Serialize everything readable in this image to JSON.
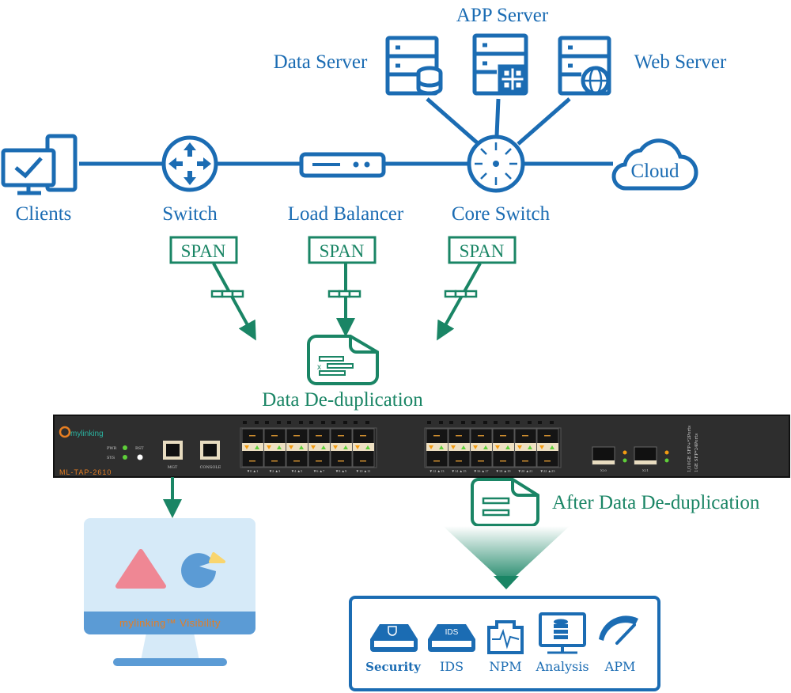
{
  "colors": {
    "network_blue": "#1b6cb3",
    "span_green": "#1a8565",
    "device_body": "#2e2e2e",
    "brand_orange": "#e67e22"
  },
  "topology": {
    "clients": "Clients",
    "switch": "Switch",
    "load_balancer": "Load Balancer",
    "core_switch": "Core Switch",
    "cloud": "Cloud",
    "data_server": "Data Server",
    "app_server": "APP Server",
    "web_server": "Web Server"
  },
  "span": {
    "label_1": "SPAN",
    "label_2": "SPAN",
    "label_3": "SPAN"
  },
  "dedup": {
    "title": "Data De-duplication",
    "after": "After Data De-duplication"
  },
  "device": {
    "brand": "mylinking",
    "trademark": "TM",
    "model": "ML-TAP-2610",
    "pwr": "PWR",
    "sys": "SYS",
    "rst": "RST",
    "mgt": "MGT",
    "console": "CONSOLE",
    "ports_group1": [
      "▼0 ▲1",
      "▼2 ▲3",
      "▼4 ▲5",
      "▼6 ▲7",
      "▼8 ▲9",
      "▼10 ▲11"
    ],
    "ports_group2": [
      "▼12 ▲13",
      "▼14 ▲15",
      "▼16 ▲17",
      "▼18 ▲19",
      "▼20 ▲21",
      "▼22 ▲23"
    ],
    "x_ports": [
      "X20",
      "X21"
    ],
    "side_text_1": "1/10GE SFP+*2Ports",
    "side_text_2": "1GE SFP*24Ports"
  },
  "monitor": {
    "caption": "mylinking™ Visibility"
  },
  "tools": [
    {
      "label": "Security",
      "icon": "shield-appliance-icon"
    },
    {
      "label": "IDS",
      "icon": "ids-appliance-icon",
      "badge": "IDS"
    },
    {
      "label": "NPM",
      "icon": "network-port-pulse-icon"
    },
    {
      "label": "Analysis",
      "icon": "monitor-database-icon"
    },
    {
      "label": "APM",
      "icon": "gauge-icon"
    }
  ]
}
